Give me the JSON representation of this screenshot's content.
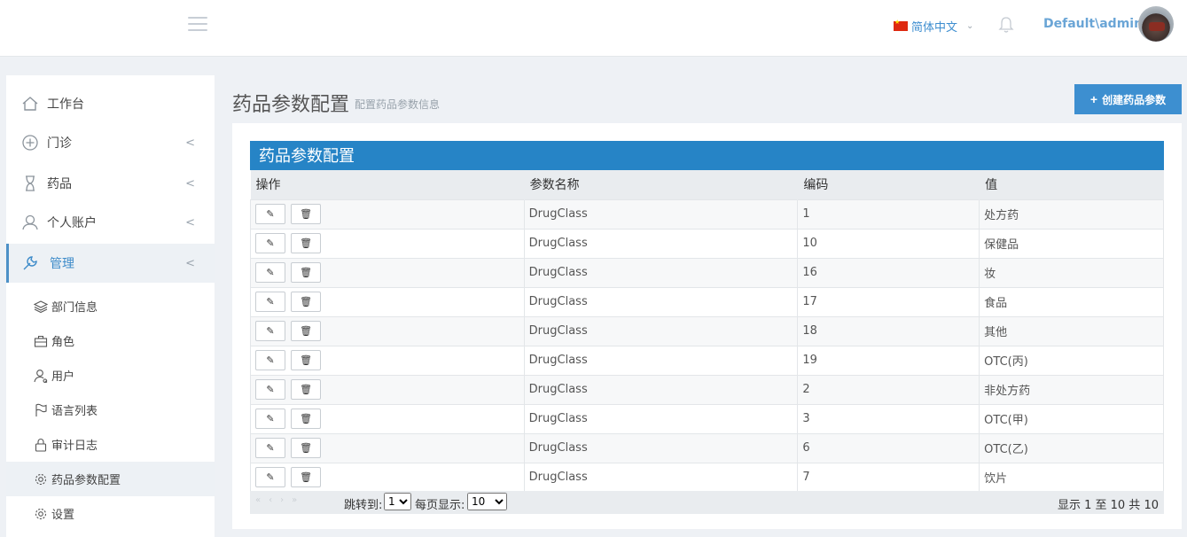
{
  "header": {
    "language_label": "简体中文",
    "user_name": "Default\\admin"
  },
  "sidebar": {
    "items": [
      {
        "label": "工作台",
        "icon": "home-icon"
      },
      {
        "label": "门诊",
        "icon": "plus-circle-icon"
      },
      {
        "label": "药品",
        "icon": "hourglass-icon"
      },
      {
        "label": "个人账户",
        "icon": "user-icon"
      },
      {
        "label": "管理",
        "icon": "wrench-icon"
      }
    ],
    "sub_items": [
      {
        "label": "部门信息",
        "icon": "layers-icon"
      },
      {
        "label": "角色",
        "icon": "briefcase-icon"
      },
      {
        "label": "用户",
        "icon": "user-search-icon"
      },
      {
        "label": "语言列表",
        "icon": "flag-icon"
      },
      {
        "label": "审计日志",
        "icon": "lock-icon"
      },
      {
        "label": "药品参数配置",
        "icon": "gear-icon"
      },
      {
        "label": "设置",
        "icon": "gear-icon"
      }
    ]
  },
  "page": {
    "title": "药品参数配置",
    "subtitle": "配置药品参数信息",
    "create_button": "创建药品参数"
  },
  "table": {
    "caption": "药品参数配置",
    "columns": [
      "操作",
      "参数名称",
      "编码",
      "值"
    ],
    "rows": [
      {
        "name": "DrugClass",
        "code": "1",
        "value": "处方药"
      },
      {
        "name": "DrugClass",
        "code": "10",
        "value": "保健品"
      },
      {
        "name": "DrugClass",
        "code": "16",
        "value": "妆"
      },
      {
        "name": "DrugClass",
        "code": "17",
        "value": "食品"
      },
      {
        "name": "DrugClass",
        "code": "18",
        "value": "其他"
      },
      {
        "name": "DrugClass",
        "code": "19",
        "value": "OTC(丙)"
      },
      {
        "name": "DrugClass",
        "code": "2",
        "value": "非处方药"
      },
      {
        "name": "DrugClass",
        "code": "3",
        "value": "OTC(甲)"
      },
      {
        "name": "DrugClass",
        "code": "6",
        "value": "OTC(乙)"
      },
      {
        "name": "DrugClass",
        "code": "7",
        "value": "饮片"
      }
    ]
  },
  "pager": {
    "jump_label": "跳转到:",
    "jump_value": "1",
    "per_page_label": "每页显示:",
    "per_page_value": "10",
    "info": "显示 1 至 10 共 10"
  },
  "colors": {
    "accent": "#2684c6",
    "button": "#3d8fd0"
  }
}
